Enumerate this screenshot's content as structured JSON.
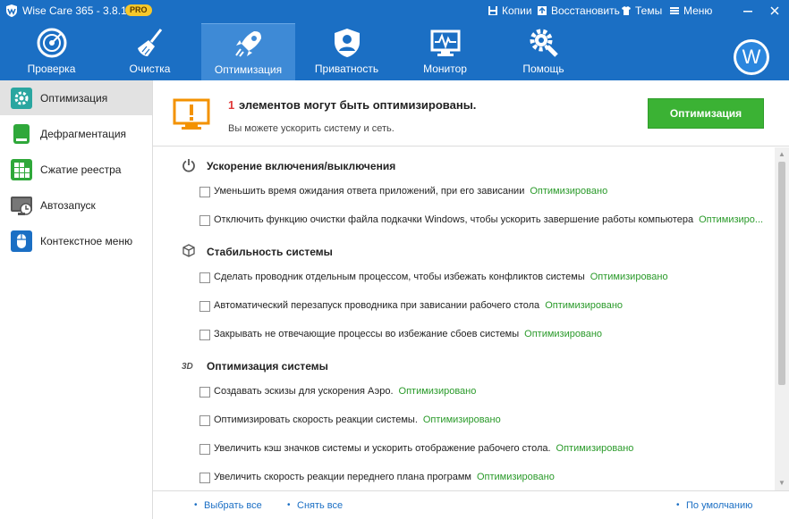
{
  "window": {
    "title": "Wise Care 365 - 3.8.1",
    "badge": "PRO",
    "buttons": {
      "backup": "Копии",
      "restore": "Восстановить",
      "themes": "Темы",
      "menu": "Меню"
    }
  },
  "nav": {
    "items": [
      {
        "label": "Проверка",
        "icon": "radar-icon"
      },
      {
        "label": "Очистка",
        "icon": "broom-icon"
      },
      {
        "label": "Оптимизация",
        "icon": "rocket-icon",
        "active": true
      },
      {
        "label": "Приватность",
        "icon": "shield-user-icon"
      },
      {
        "label": "Монитор",
        "icon": "monitor-icon"
      },
      {
        "label": "Помощь",
        "icon": "gear-wrench-icon"
      }
    ],
    "avatar_letter": "W"
  },
  "sidebar": {
    "items": [
      {
        "label": "Оптимизация",
        "active": true
      },
      {
        "label": "Дефрагментация"
      },
      {
        "label": "Сжатие реестра"
      },
      {
        "label": "Автозапуск"
      },
      {
        "label": "Контекстное меню"
      }
    ]
  },
  "header": {
    "count": "1",
    "title": "элементов могут быть оптимизированы.",
    "subtitle": "Вы можете ускорить систему и сеть.",
    "optimize_button": "Оптимизация"
  },
  "sections": [
    {
      "title": "Ускорение включения/выключения",
      "items": [
        {
          "text": "Уменьшить время ожидания ответа приложений, при его зависании",
          "status": "Оптимизировано"
        },
        {
          "text": "Отключить функцию очистки файла подкачки Windows, чтобы ускорить завершение работы компьютера",
          "status": "Оптимизиро..."
        }
      ]
    },
    {
      "title": "Стабильность системы",
      "items": [
        {
          "text": "Сделать проводник отдельным процессом, чтобы избежать конфликтов системы",
          "status": "Оптимизировано"
        },
        {
          "text": "Автоматический перезапуск проводника при зависании рабочего стола",
          "status": "Оптимизировано"
        },
        {
          "text": "Закрывать не отвечающие процессы во избежание сбоев системы",
          "status": "Оптимизировано"
        }
      ]
    },
    {
      "title": "Оптимизация системы",
      "items": [
        {
          "text": "Создавать эскизы для ускорения Аэро.",
          "status": "Оптимизировано"
        },
        {
          "text": "Оптимизировать скорость реакции системы.",
          "status": "Оптимизировано"
        },
        {
          "text": "Увеличить кэш значков системы и ускорить отображение рабочего стола.",
          "status": "Оптимизировано"
        },
        {
          "text": "Увеличить скорость реакции переднего плана программ",
          "status": "Оптимизировано"
        }
      ]
    }
  ],
  "footer": {
    "select_all": "Выбрать все",
    "deselect_all": "Снять все",
    "default": "По умолчанию"
  }
}
